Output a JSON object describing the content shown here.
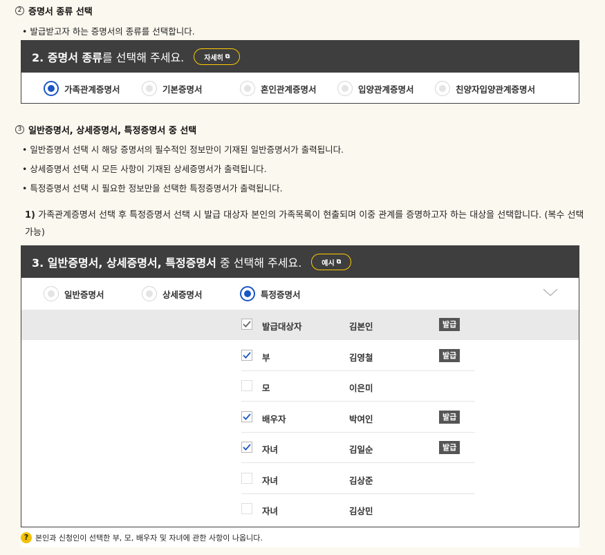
{
  "section2": {
    "num": "2",
    "title": "증명서 종류 선택",
    "bullet": "• 발급받고자 하는 증명서의 종류를 선택합니다.",
    "panel": {
      "head_bold": "2. 증명서 종류",
      "head_rest": "를 선택해 주세요.",
      "detail_button": "자세히",
      "options": [
        "가족관계증명서",
        "기본증명서",
        "혼인관계증명서",
        "입양관계증명서",
        "친양자입양관계증명서"
      ],
      "selected": "가족관계증명서"
    }
  },
  "section3": {
    "num": "3",
    "title": "일반증명서, 상세증명서, 특정증명서 중 선택",
    "bullets": [
      "• 일반증명서 선택 시 해당 증명서의 필수적인 정보만이 기재된 일반증명서가 출력됩니다.",
      "• 상세증명서 선택 시 모든 사항이 기재된 상세증명서가 출력됩니다.",
      "• 특정증명서 선택 시 필요한 정보만을 선택한 특정증명서가 출력됩니다."
    ],
    "para_num": "1)",
    "para_text": " 가족관계증명서 선택 후 특정증명서 선택 시 발급 대상자 본인의 가족목록이 현출되며 이중 관계를 증명하고자 하는 대상을 선택합니다. (복수 선택 가능)",
    "panel": {
      "head_bold": "3. 일반증명서, 상세증명서, 특정증명서",
      "head_rest": " 중 선택해 주세요.",
      "example_button": "예시",
      "options": [
        "일반증명서",
        "상세증명서",
        "특정증명서"
      ],
      "selected": "특정증명서"
    },
    "family": [
      {
        "relation": "발급대상자",
        "name": "김본인",
        "checked": true,
        "badge": "발급",
        "checkbox_color": "#666666"
      },
      {
        "relation": "부",
        "name": "김영철",
        "checked": true,
        "badge": "발급",
        "checkbox_color": "#1a56c4"
      },
      {
        "relation": "모",
        "name": "이은미",
        "checked": false,
        "badge": ""
      },
      {
        "relation": "배우자",
        "name": "박여인",
        "checked": true,
        "badge": "발급",
        "checkbox_color": "#1a56c4"
      },
      {
        "relation": "자녀",
        "name": "김일순",
        "checked": true,
        "badge": "발급",
        "checkbox_color": "#1a56c4"
      },
      {
        "relation": "자녀",
        "name": "김상준",
        "checked": false,
        "badge": ""
      },
      {
        "relation": "자녀",
        "name": "김상민",
        "checked": false,
        "badge": ""
      }
    ],
    "note": "본인과 신청인이 선택한 부, 모, 배우자 및 자녀에 관한 사항이 나옵니다."
  },
  "colors": {
    "header_bg": "#3e3e3e",
    "accent_blue": "#1a56c4",
    "pill_border": "#ffcc00",
    "badge_bg": "#555555",
    "page_bg": "#fbf8ef"
  }
}
